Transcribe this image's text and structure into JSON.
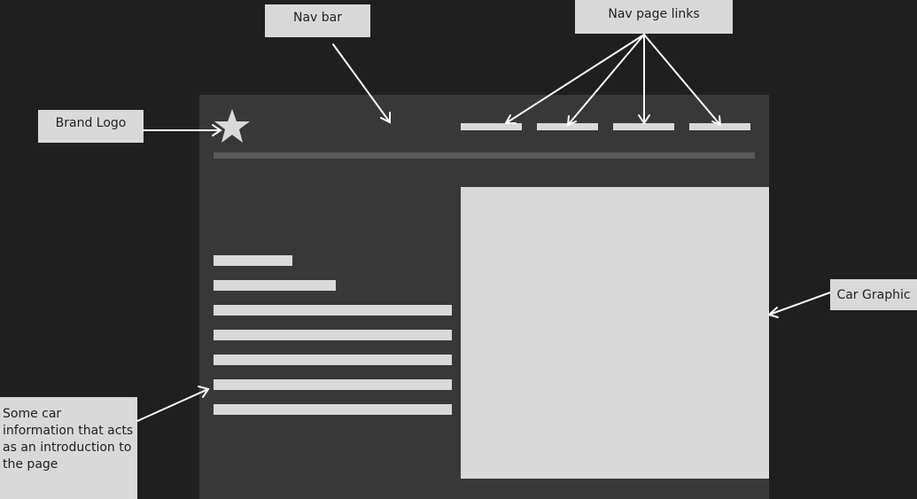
{
  "annotations": {
    "nav_bar": "Nav bar",
    "nav_page_links": "Nav page links",
    "brand_logo": "Brand Logo",
    "car_graphic": "Car Graphic",
    "intro_text": "Some car information that acts as an introduction to the page"
  },
  "mockup": {
    "logo_icon": "star-icon",
    "nav_link_count": 4,
    "text_line_count": 7
  },
  "colors": {
    "background": "#1f1f1f",
    "mockup_panel": "#383838",
    "placeholder": "#d9d9d9",
    "divider": "#5a5a5a",
    "arrow": "#ffffff"
  }
}
